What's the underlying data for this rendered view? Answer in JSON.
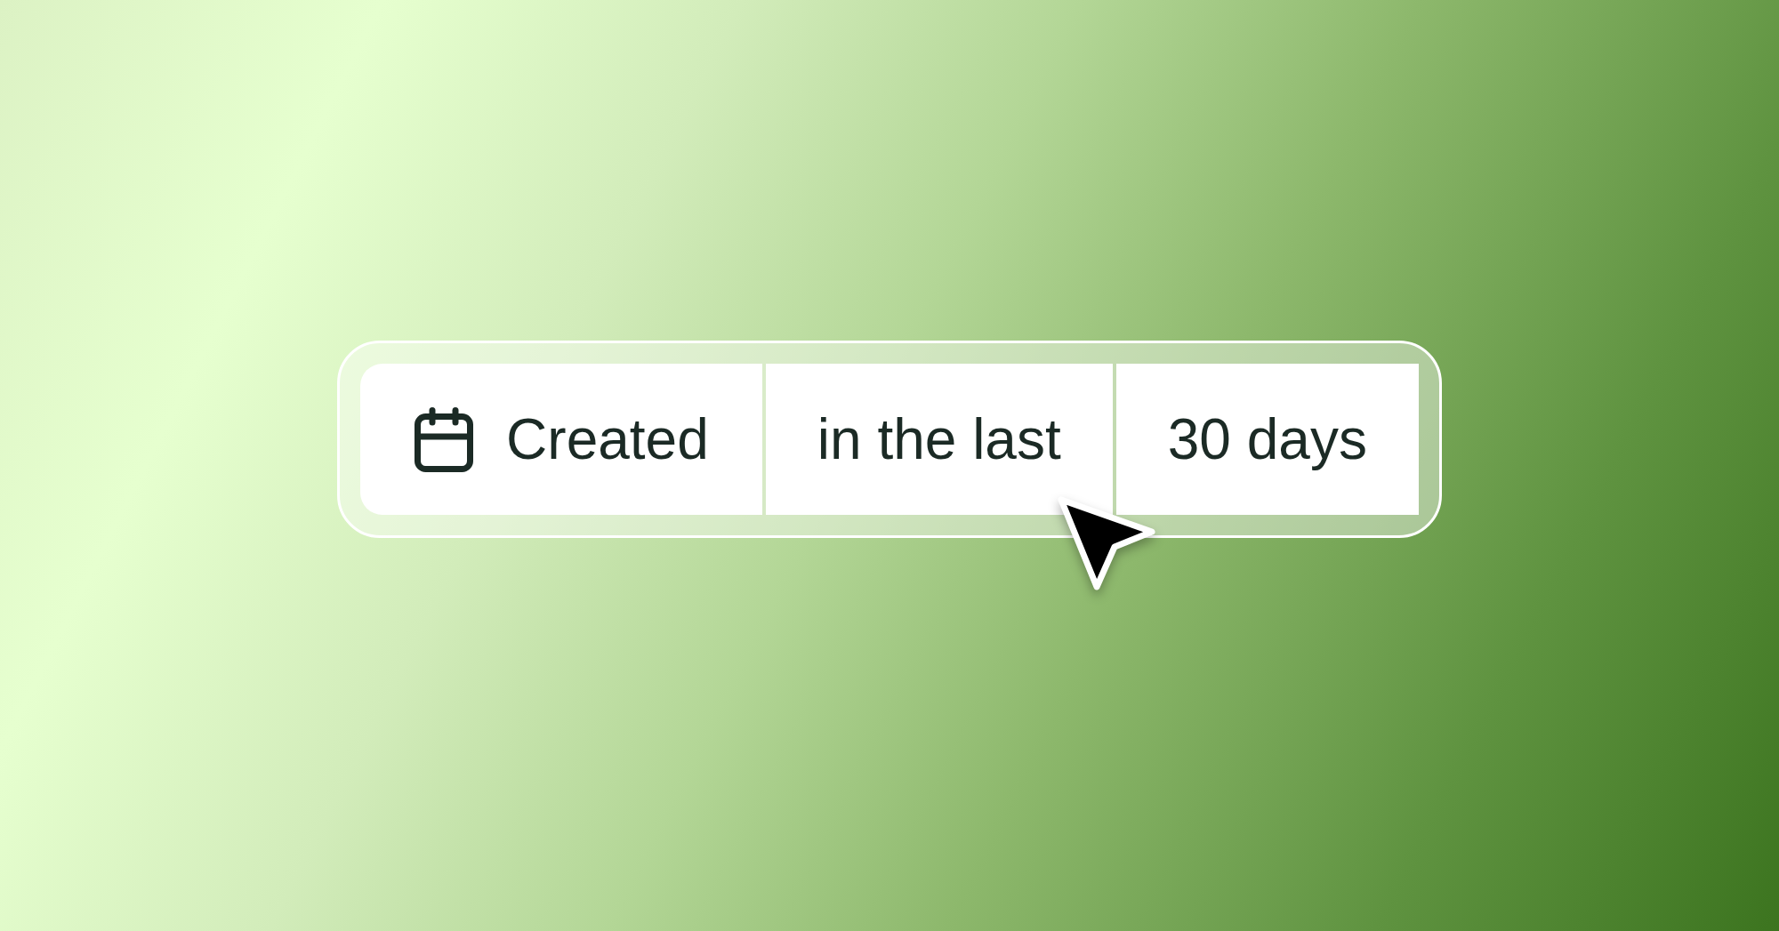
{
  "filter_bar": {
    "segments": [
      {
        "kind": "property",
        "label": "Created"
      },
      {
        "kind": "operator",
        "label": "in the last"
      },
      {
        "kind": "value",
        "label": "30 days"
      }
    ]
  }
}
